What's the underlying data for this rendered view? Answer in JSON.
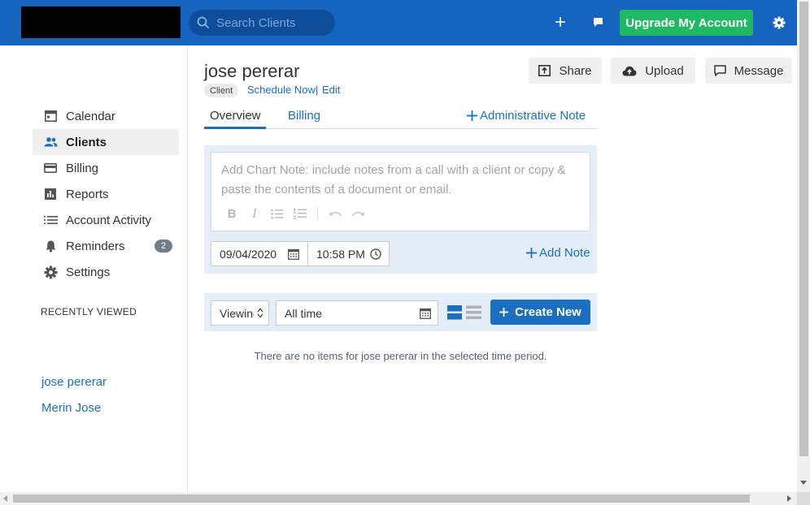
{
  "topbar": {
    "search_placeholder": "Search Clients",
    "upgrade_label": "Upgrade My Account",
    "colors": {
      "bar": "#1565c0",
      "upgrade": "#1fb964"
    }
  },
  "sidebar": {
    "items": [
      {
        "label": "Calendar",
        "icon": "calendar-icon"
      },
      {
        "label": "Clients",
        "icon": "clients-icon",
        "active": true
      },
      {
        "label": "Billing",
        "icon": "billing-icon"
      },
      {
        "label": "Reports",
        "icon": "reports-icon"
      },
      {
        "label": "Account Activity",
        "icon": "list-icon"
      },
      {
        "label": "Reminders",
        "icon": "bell-icon",
        "badge": "2"
      },
      {
        "label": "Settings",
        "icon": "gear-icon"
      }
    ],
    "recent_title": "RECENTLY VIEWED",
    "recent": [
      "jose pererar",
      "Merin Jose"
    ]
  },
  "header": {
    "client_name": "jose pererar",
    "chip": "Client",
    "schedule_link": "Schedule Now",
    "separator": "|",
    "edit_link": "Edit",
    "share": "Share",
    "upload": "Upload",
    "message": "Message"
  },
  "tabs": {
    "overview": "Overview",
    "billing": "Billing",
    "admin_note": "Administrative Note"
  },
  "note": {
    "placeholder": "Add Chart Note: include notes from a call with a client or copy & paste the contents of a document or email.",
    "date": "09/04/2020",
    "time": "10:58 PM",
    "add_note": "Add Note"
  },
  "filters": {
    "viewing": "Viewing",
    "time_range": "All time",
    "create_new": "Create New"
  },
  "empty_message": "There are no items for jose pererar in the selected time period."
}
